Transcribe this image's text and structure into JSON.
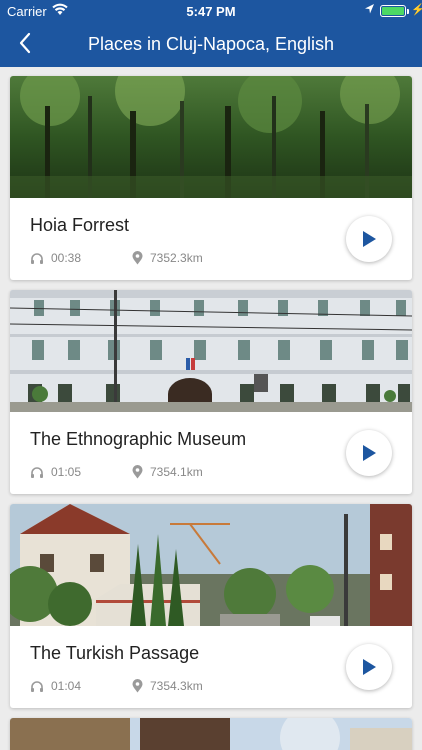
{
  "status_bar": {
    "carrier": "Carrier",
    "time": "5:47 PM"
  },
  "header": {
    "title": "Places in Cluj-Napoca, English"
  },
  "places": [
    {
      "name": "Hoia Forrest",
      "duration": "00:38",
      "distance": "7352.3km"
    },
    {
      "name": "The Ethnographic Museum",
      "duration": "01:05",
      "distance": "7354.1km"
    },
    {
      "name": "The Turkish Passage",
      "duration": "01:04",
      "distance": "7354.3km"
    }
  ],
  "colors": {
    "header": "#1d56a0",
    "accent": "#1d56a0",
    "background": "#ececec"
  }
}
